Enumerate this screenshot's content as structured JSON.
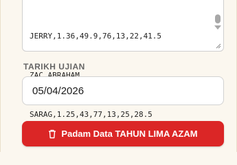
{
  "textarea": {
    "lines": [
      "JERRY,1.36,49.9,76,13,22,41.5",
      "ZAC ABRAHAM",
      "SARAG,1.25,43,77,13,25,28.5"
    ]
  },
  "date_field": {
    "label": "TARIKH UJIAN",
    "value": "05/04/2026"
  },
  "delete_button": {
    "label": "Padam Data TAHUN LIMA AZAM",
    "icon": "trash-icon",
    "color": "#db2626"
  }
}
